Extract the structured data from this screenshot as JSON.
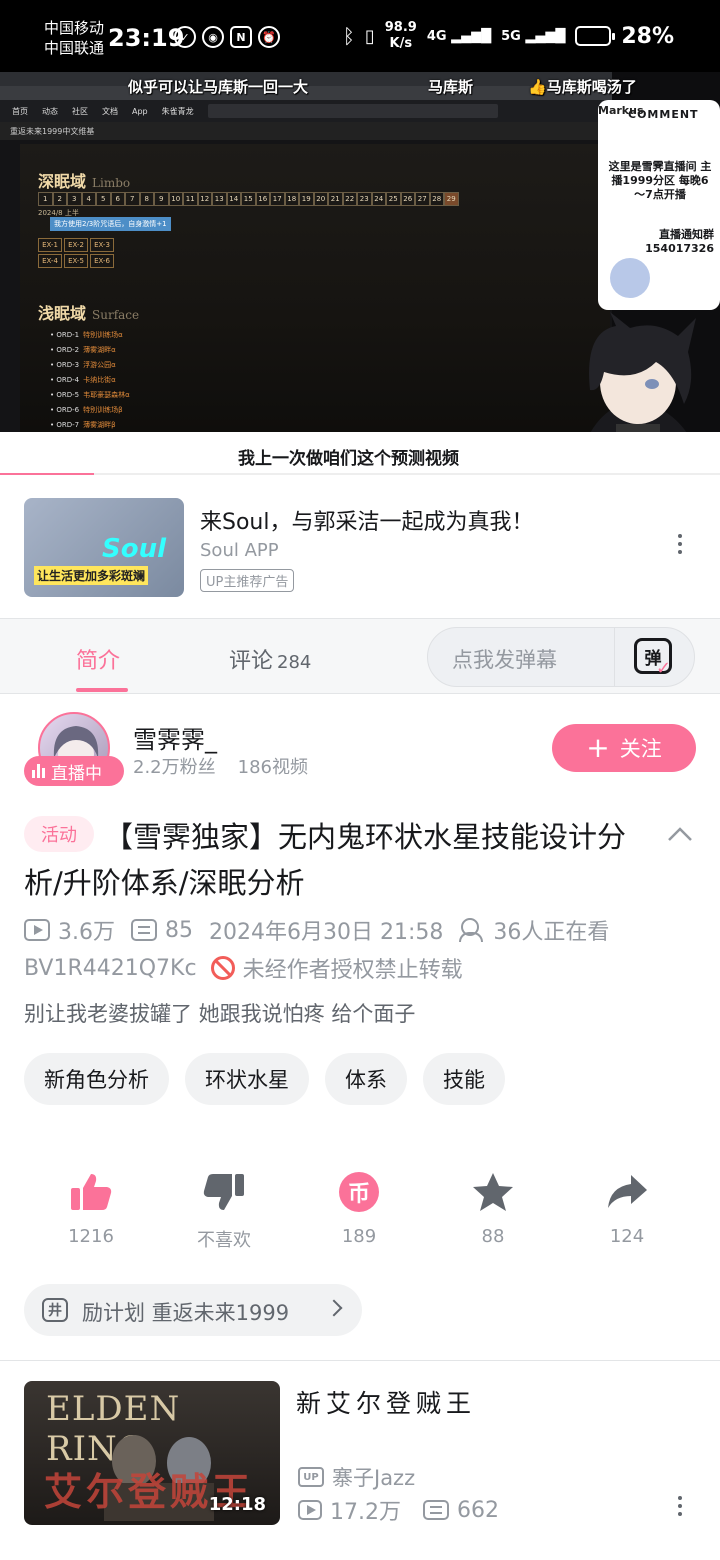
{
  "status_bar": {
    "carrier1": "中国移动",
    "carrier2": "中国联通",
    "time": "23:19",
    "net_speed_value": "98.9",
    "net_speed_unit": "K/s",
    "sig1": "4G",
    "sig2": "5G",
    "battery": "28%"
  },
  "video": {
    "danmaku": [
      "似乎可以让马库斯一回一大",
      "马库斯",
      "马库斯喝汤了"
    ],
    "wiki_nav": [
      "首页",
      "动态",
      "社区",
      "文档",
      "App",
      "朱雀青龙"
    ],
    "wiki_sub": "重返未来1999中文维基",
    "limbo_title": "深眠域",
    "limbo_en": "Limbo",
    "limbo_numbers": [
      "1",
      "2",
      "3",
      "4",
      "5",
      "6",
      "7",
      "8",
      "9",
      "10",
      "11",
      "12",
      "13",
      "14",
      "15",
      "16",
      "17",
      "18",
      "19",
      "20",
      "21",
      "22",
      "23",
      "24",
      "25",
      "26",
      "27",
      "28",
      "29"
    ],
    "limbo_period": "2024/8 上半",
    "limbo_btn": "我方使用2/3阶咒语后，自身激情+1",
    "ex_buttons": [
      "EX-1",
      "EX-2",
      "EX-3",
      "EX-4",
      "EX-5",
      "EX-6"
    ],
    "surface_title": "浅眠域",
    "surface_en": "Surface",
    "ord_list": [
      {
        "code": "ORD-1",
        "name": "特别训练场α"
      },
      {
        "code": "ORD-2",
        "name": "薄雾湖畔α"
      },
      {
        "code": "ORD-3",
        "name": "浮游公园α"
      },
      {
        "code": "ORD-4",
        "name": "卡纳比街α"
      },
      {
        "code": "ORD-5",
        "name": "韦耶豪瑟森林α"
      },
      {
        "code": "ORD-6",
        "name": "特别训练场β"
      },
      {
        "code": "ORD-7",
        "name": "薄雾湖畔β"
      }
    ],
    "comment_panel_title": "COMMENT",
    "comment_panel_name": "Markus",
    "comment_panel_text1": "这里是雪霁直播间 主播1999分区 每晚6～7点开播",
    "comment_panel_text2": "直播通知群 154017326",
    "subtitle": "我上一次做咱们这个预测视频",
    "progress": 0.13
  },
  "ad": {
    "thumb_text": "Soul",
    "thumb_caption": "让生活更加多彩斑斓",
    "title": "来Soul，与郭采洁一起成为真我！",
    "subtitle": "Soul APP",
    "tag": "UP主推荐广告"
  },
  "tabs": {
    "intro": "简介",
    "comments": "评论",
    "comments_count": "284",
    "danmaku_placeholder": "点我发弹幕",
    "danmaku_icon": "弹"
  },
  "author": {
    "name": "雪霁霁_",
    "fans": "2.2万粉丝",
    "videos": "186视频",
    "live_badge": "直播中",
    "follow": "关注"
  },
  "video_info": {
    "activity_tag": "活动",
    "title": "【雪霁独家】无内鬼环状水星技能设计分析/升阶体系/深眠分析",
    "plays": "3.6万",
    "danmaku_count": "85",
    "date": "2024年6月30日 21:58",
    "watching": "36人正在看",
    "bvid": "BV1R4421Q7Kc",
    "copyright": "未经作者授权禁止转载",
    "description": "别让我老婆拔罐了 她跟我说怕疼 给个面子",
    "tags": [
      "新角色分析",
      "环状水星",
      "体系",
      "技能"
    ]
  },
  "actions": {
    "like": "1216",
    "dislike": "不喜欢",
    "coin": "189",
    "coin_icon": "币",
    "favorite": "88",
    "share": "124"
  },
  "plan": {
    "icon": "井",
    "text": "励计划   重返未来1999"
  },
  "related": {
    "thumb_en": "ELDEN RING",
    "thumb_cn": "艾尔登贼王",
    "duration": "12:18",
    "title": "新艾尔登贼王",
    "up_badge": "UP",
    "up_name": "寨子Jazz",
    "plays": "17.2万",
    "danmaku": "662"
  },
  "colors": {
    "brand_pink": "#fb7299",
    "text_primary": "#18191c",
    "text_secondary": "#9499a0",
    "warn_red": "#f25d59"
  }
}
